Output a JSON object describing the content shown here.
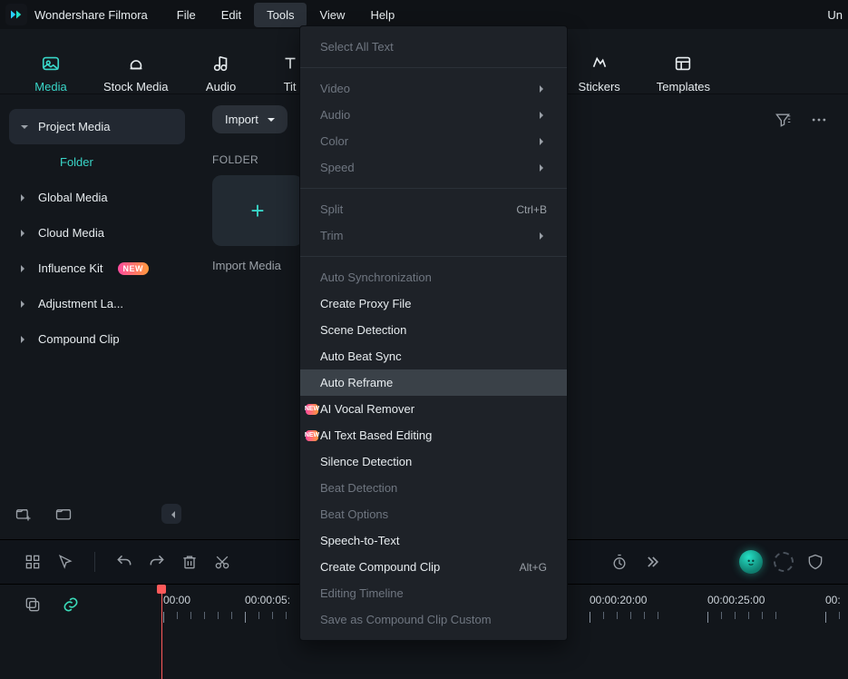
{
  "app": {
    "name": "Wondershare Filmora",
    "right_label": "Un"
  },
  "menubar": [
    "File",
    "Edit",
    "Tools",
    "View",
    "Help"
  ],
  "menubar_active_index": 2,
  "ribbon": {
    "tabs": [
      {
        "key": "media",
        "label": "Media"
      },
      {
        "key": "stock",
        "label": "Stock Media"
      },
      {
        "key": "audio",
        "label": "Audio"
      },
      {
        "key": "titles",
        "label": "Tit"
      },
      {
        "key": "stickers",
        "label": "Stickers"
      },
      {
        "key": "templates",
        "label": "Templates"
      }
    ],
    "active_key": "media"
  },
  "sidebar": {
    "items": [
      {
        "label": "Project Media",
        "expanded": true
      },
      {
        "label": "Folder",
        "sub": true,
        "active": true
      },
      {
        "label": "Global Media"
      },
      {
        "label": "Cloud Media"
      },
      {
        "label": "Influence Kit",
        "badge": "NEW"
      },
      {
        "label": "Adjustment La..."
      },
      {
        "label": "Compound Clip"
      }
    ]
  },
  "content": {
    "import_label": "Import",
    "section_label": "FOLDER",
    "import_caption": "Import Media"
  },
  "tools_menu": {
    "items": [
      {
        "label": "Select All Text",
        "disabled": true
      },
      {
        "sep": true
      },
      {
        "label": "Video",
        "disabled": true,
        "submenu": true
      },
      {
        "label": "Audio",
        "disabled": true,
        "submenu": true
      },
      {
        "label": "Color",
        "disabled": true,
        "submenu": true
      },
      {
        "label": "Speed",
        "disabled": true,
        "submenu": true
      },
      {
        "sep": true
      },
      {
        "label": "Split",
        "disabled": true,
        "shortcut": "Ctrl+B"
      },
      {
        "label": "Trim",
        "disabled": true,
        "submenu": true
      },
      {
        "sep": true
      },
      {
        "label": "Auto Synchronization",
        "disabled": true
      },
      {
        "label": "Create Proxy File"
      },
      {
        "label": "Scene Detection"
      },
      {
        "label": "Auto Beat Sync"
      },
      {
        "label": "Auto Reframe",
        "hover": true
      },
      {
        "label": "AI Vocal Remover",
        "badge": "NEW"
      },
      {
        "label": "AI Text Based Editing",
        "badge": "NEW"
      },
      {
        "label": "Silence Detection"
      },
      {
        "label": "Beat Detection",
        "disabled": true
      },
      {
        "label": "Beat Options",
        "disabled": true
      },
      {
        "label": "Speech-to-Text"
      },
      {
        "label": "Create Compound Clip",
        "shortcut": "Alt+G"
      },
      {
        "label": "Editing Timeline",
        "disabled": true
      },
      {
        "label": "Save as Compound Clip Custom",
        "disabled": true
      }
    ]
  },
  "timeline": {
    "labels": [
      "00:00",
      "00:00:05:",
      "00:00:20:00",
      "00:00:25:00",
      "00:"
    ]
  }
}
